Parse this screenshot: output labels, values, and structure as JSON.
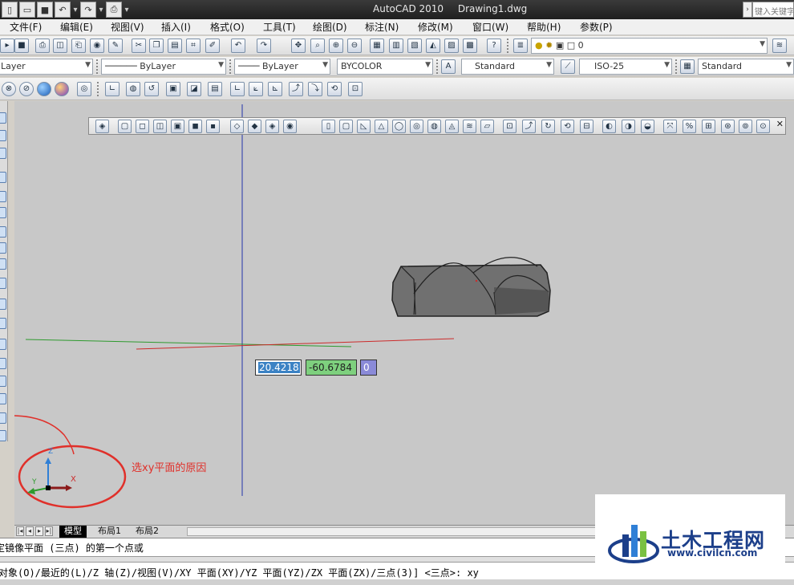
{
  "window": {
    "app_title": "AutoCAD 2010",
    "document_title": "Drawing1.dwg",
    "search_placeholder": "键入关键字"
  },
  "menu": [
    "文件(F)",
    "编辑(E)",
    "视图(V)",
    "插入(I)",
    "格式(O)",
    "工具(T)",
    "绘图(D)",
    "标注(N)",
    "修改(M)",
    "窗口(W)",
    "帮助(H)",
    "参数(P)"
  ],
  "toolbar_layer": {
    "layer_value": "0"
  },
  "toolbar_props": {
    "layer_combo": "Layer",
    "linetype": "ByLayer",
    "lineweight": "ByLayer",
    "color": "BYCOLOR",
    "text_style": "Standard",
    "dim_style": "ISO-25",
    "table_style": "Standard"
  },
  "coordinates": {
    "x": "20.4218",
    "y": "-60.6784",
    "z": "0"
  },
  "ucs": {
    "z_label": "Z",
    "y_label": "Y",
    "x_label": "X"
  },
  "annotation": "选xy平面的原因",
  "tabs": {
    "model": "模型",
    "layout1": "布局1",
    "layout2": "布局2"
  },
  "command": {
    "line1": "定镜像平面 (三点) 的第一个点或",
    "line2": "对象(O)/最近的(L)/Z 轴(Z)/视图(V)/XY 平面(XY)/YZ 平面(YZ)/ZX 平面(ZX)/三点(3)] <三点>: xy"
  },
  "watermark": {
    "name": "土木工程网",
    "url": "www.civilcn.com"
  },
  "colors": {
    "viewport_bg": "#c8c8c8",
    "x_axis": "#cc2b2b",
    "y_axis": "#2e9a2e",
    "z_axis": "#2f7fd6",
    "annotation": "#e0302a",
    "crosshair_v": "#2233aa",
    "brand": "#1c3f8a"
  }
}
